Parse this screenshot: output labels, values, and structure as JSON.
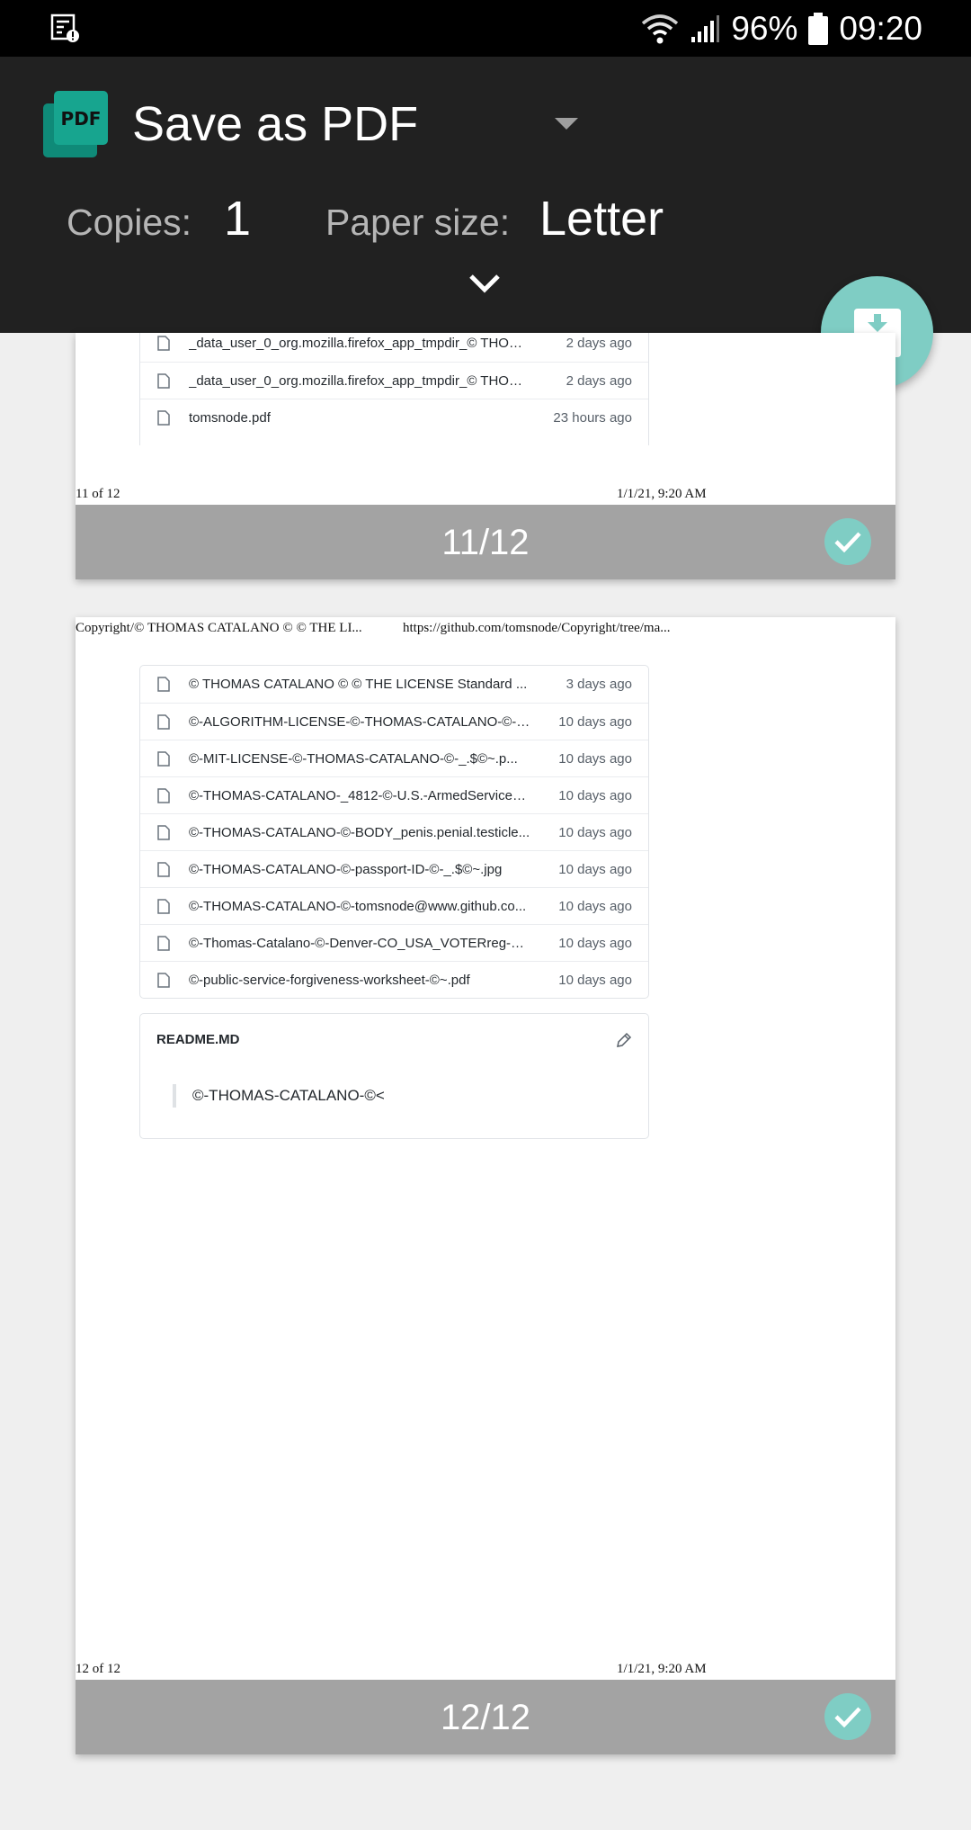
{
  "status_bar": {
    "battery_percent": "96%",
    "time": "09:20"
  },
  "header": {
    "title": "Save as PDF",
    "copies_label": "Copies:",
    "copies_value": "1",
    "paper_size_label": "Paper size:",
    "paper_size_value": "Letter"
  },
  "pages": [
    {
      "page_number": "11/12",
      "footer_left": "11 of 12",
      "footer_right": "1/1/21, 9:20 AM",
      "files": [
        {
          "name": "_data_user_0_org.mozilla.firefox_app_tmpdir_© THOMA...",
          "date": "2 days ago"
        },
        {
          "name": "_data_user_0_org.mozilla.firefox_app_tmpdir_© THOMA...",
          "date": "2 days ago"
        },
        {
          "name": "tomsnode.pdf",
          "date": "23 hours ago"
        }
      ]
    },
    {
      "page_number": "12/12",
      "header_left": "Copyright/© THOMAS CATALANO © © THE LI...",
      "header_right": "https://github.com/tomsnode/Copyright/tree/ma...",
      "footer_left": "12 of 12",
      "footer_right": "1/1/21, 9:20 AM",
      "files": [
        {
          "name": "© THOMAS CATALANO © © THE LICENSE Standard ...",
          "date": "3 days ago"
        },
        {
          "name": "©-ALGORITHM-LICENSE-©-THOMAS-CATALANO-©-_....",
          "date": "10 days ago"
        },
        {
          "name": "©-MIT-LICENSE-©-THOMAS-CATALANO-©-_.$©~.p...",
          "date": "10 days ago"
        },
        {
          "name": "©-THOMAS-CATALANO-_4812-©-U.S.-ArmedServiceS...",
          "date": "10 days ago"
        },
        {
          "name": "©-THOMAS-CATALANO-©-BODY_penis.penial.testicle...",
          "date": "10 days ago"
        },
        {
          "name": "©-THOMAS-CATALANO-©-passport-ID-©-_.$©~.jpg",
          "date": "10 days ago"
        },
        {
          "name": "©-THOMAS-CATALANO-©-tomsnode@www.github.co...",
          "date": "10 days ago"
        },
        {
          "name": "©-Thomas-Catalano-©-Denver-CO_USA_VOTERreg-©-...",
          "date": "10 days ago"
        },
        {
          "name": "©-public-service-forgiveness-worksheet-©~.pdf",
          "date": "10 days ago"
        }
      ],
      "readme": {
        "title": "README.MD",
        "quote": "©-THOMAS-CATALANO-©<"
      }
    }
  ],
  "colors": {
    "header_bg": "#212121",
    "accent": "#7fcdc4",
    "footer_bar": "#a3a3a3"
  }
}
